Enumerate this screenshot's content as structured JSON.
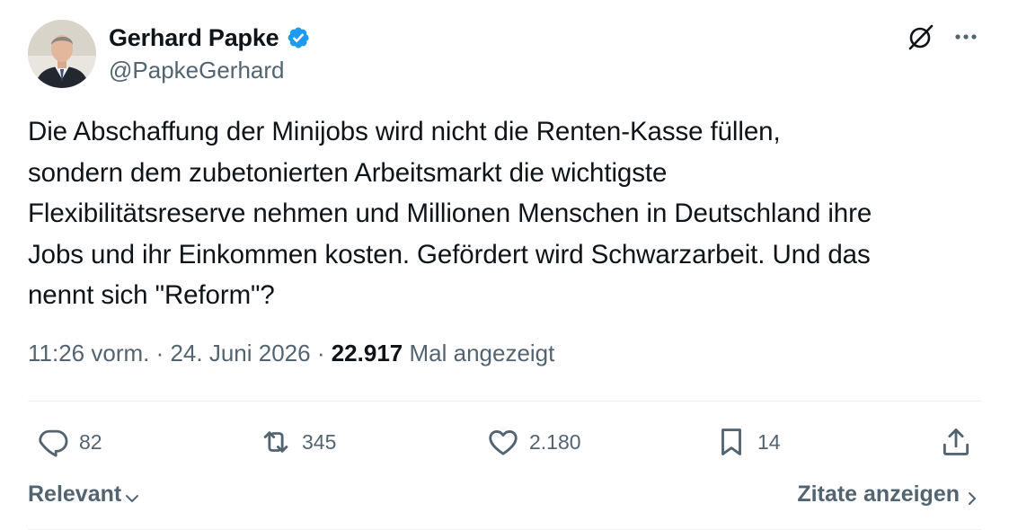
{
  "author": {
    "display_name": "Gerhard Papke",
    "handle": "@PapkeGerhard",
    "verified": true
  },
  "tweet": {
    "lines": [
      "Die Abschaffung der Minijobs wird nicht die Renten-Kasse füllen,",
      "sondern dem zubetonierten Arbeitsmarkt die wichtigste",
      "Flexibilitätsreserve nehmen und Millionen Menschen in Deutschland ihre",
      "Jobs und ihr Einkommen kosten. Gefördert wird Schwarzarbeit. Und das",
      "nennt sich \"Reform\"?"
    ]
  },
  "meta": {
    "time": "11:26 vorm.",
    "separator": " · ",
    "date": "24. Juni 2026",
    "views_count": "22.917",
    "views_label": "Mal angezeigt"
  },
  "actions": {
    "replies": "82",
    "retweets": "345",
    "likes": "2.180",
    "bookmarks": "14"
  },
  "footer": {
    "sort_label": "Relevant",
    "quotes_label": "Zitate anzeigen"
  },
  "colors": {
    "text": "#0f1419",
    "secondary": "#536471",
    "verified": "#1d9bf0",
    "divider": "#eff3f4"
  },
  "icons": [
    "verified-badge-icon",
    "grok-icon",
    "more-icon",
    "reply-icon",
    "retweet-icon",
    "like-icon",
    "bookmark-icon",
    "share-icon",
    "chevron-down-icon",
    "chevron-right-icon"
  ]
}
